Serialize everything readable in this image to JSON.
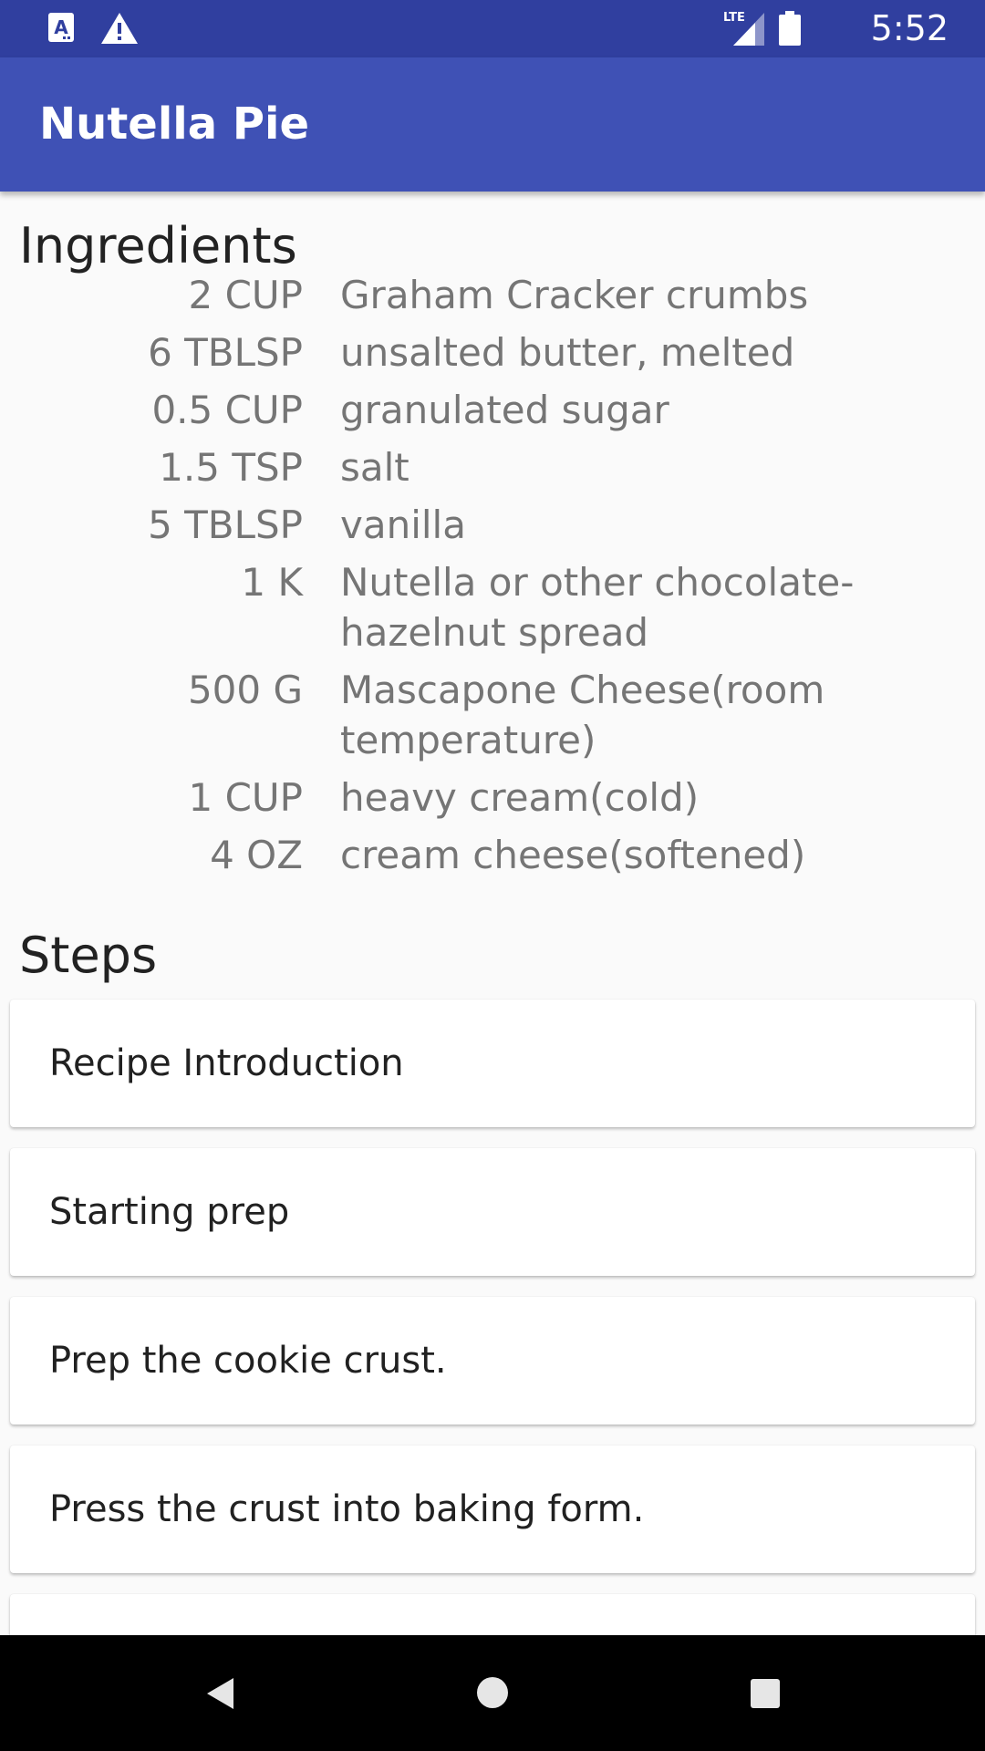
{
  "status_bar": {
    "time": "5:52",
    "left_icons": [
      "text-a-icon",
      "warning-icon"
    ],
    "right_icons": [
      "lte-signal-icon",
      "battery-icon"
    ],
    "network_label": "LTE"
  },
  "app_bar": {
    "title": "Nutella Pie",
    "color": "#3f51b5",
    "status_color": "#303f9f"
  },
  "ingredients": {
    "heading": "Ingredients",
    "items": [
      {
        "qty": "2 CUP",
        "name": "Graham Cracker crumbs"
      },
      {
        "qty": "6 TBLSP",
        "name": "unsalted butter, melted"
      },
      {
        "qty": "0.5 CUP",
        "name": "granulated sugar"
      },
      {
        "qty": "1.5 TSP",
        "name": "salt"
      },
      {
        "qty": "5 TBLSP",
        "name": "vanilla"
      },
      {
        "qty": "1 K",
        "name": "Nutella or other chocolate-hazelnut spread"
      },
      {
        "qty": "500 G",
        "name": "Mascapone Cheese(room temperature)"
      },
      {
        "qty": "1 CUP",
        "name": "heavy cream(cold)"
      },
      {
        "qty": "4 OZ",
        "name": "cream cheese(softened)"
      }
    ]
  },
  "steps": {
    "heading": "Steps",
    "items": [
      {
        "label": "Recipe Introduction"
      },
      {
        "label": "Starting prep"
      },
      {
        "label": "Prep the cookie crust."
      },
      {
        "label": "Press the crust into baking form."
      },
      {
        "label": ""
      }
    ]
  },
  "nav_bar": {
    "icons": [
      "back-icon",
      "home-icon",
      "recents-icon"
    ]
  }
}
